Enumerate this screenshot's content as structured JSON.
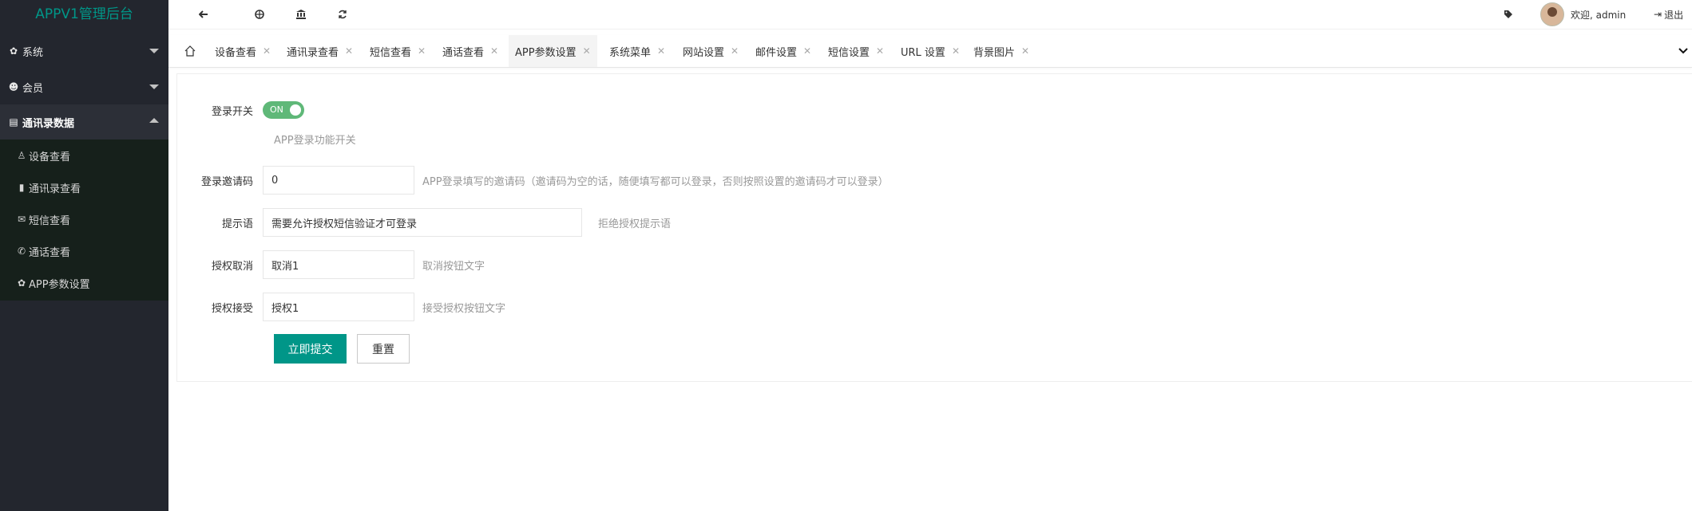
{
  "app": {
    "title": "APPV1管理后台"
  },
  "sidebar": {
    "items": [
      {
        "label": "系统",
        "icon": "gear-icon",
        "expanded": false
      },
      {
        "label": "会员",
        "icon": "users-icon",
        "expanded": false
      },
      {
        "label": "通讯录数据",
        "icon": "table-icon",
        "expanded": true
      }
    ],
    "subitems": [
      {
        "label": "设备查看",
        "icon": "user-outline-icon"
      },
      {
        "label": "通讯录查看",
        "icon": "book-icon"
      },
      {
        "label": "短信查看",
        "icon": "envelope-icon"
      },
      {
        "label": "通话查看",
        "icon": "phone-icon"
      },
      {
        "label": "APP参数设置",
        "icon": "gear-icon"
      }
    ]
  },
  "header": {
    "welcome": "欢迎, admin",
    "logout": "退出",
    "icons": [
      "back-icon",
      "globe-icon",
      "bank-icon",
      "refresh-icon",
      "tag-icon"
    ]
  },
  "tabs": [
    {
      "label": "设备查看",
      "active": false
    },
    {
      "label": "通讯录查看",
      "active": false
    },
    {
      "label": "短信查看",
      "active": false
    },
    {
      "label": "通话查看",
      "active": false
    },
    {
      "label": "APP参数设置",
      "active": true
    },
    {
      "label": "系统菜单",
      "active": false
    },
    {
      "label": "网站设置",
      "active": false
    },
    {
      "label": "邮件设置",
      "active": false
    },
    {
      "label": "短信设置",
      "active": false
    },
    {
      "label": "URL 设置",
      "active": false
    },
    {
      "label": "背景图片",
      "active": false
    }
  ],
  "form": {
    "login_switch": {
      "label": "登录开关",
      "state": "ON",
      "hint": "APP登录功能开关"
    },
    "invite_code": {
      "label": "登录邀请码",
      "value": "0",
      "hint": "APP登录填写的邀请码（邀请码为空的话，随便填写都可以登录，否则按照设置的邀请码才可以登录）"
    },
    "prompt": {
      "label": "提示语",
      "value": "需要允许授权短信验证才可登录",
      "hint": "拒绝授权提示语"
    },
    "auth_cancel": {
      "label": "授权取消",
      "value": "取消1",
      "hint": "取消按钮文字"
    },
    "auth_accept": {
      "label": "授权接受",
      "value": "授权1",
      "hint": "接受授权按钮文字"
    },
    "submit_label": "立即提交",
    "reset_label": "重置"
  },
  "colors": {
    "sidebar_bg": "#23262e",
    "accent": "#009688",
    "switch_on": "#5fb878"
  }
}
